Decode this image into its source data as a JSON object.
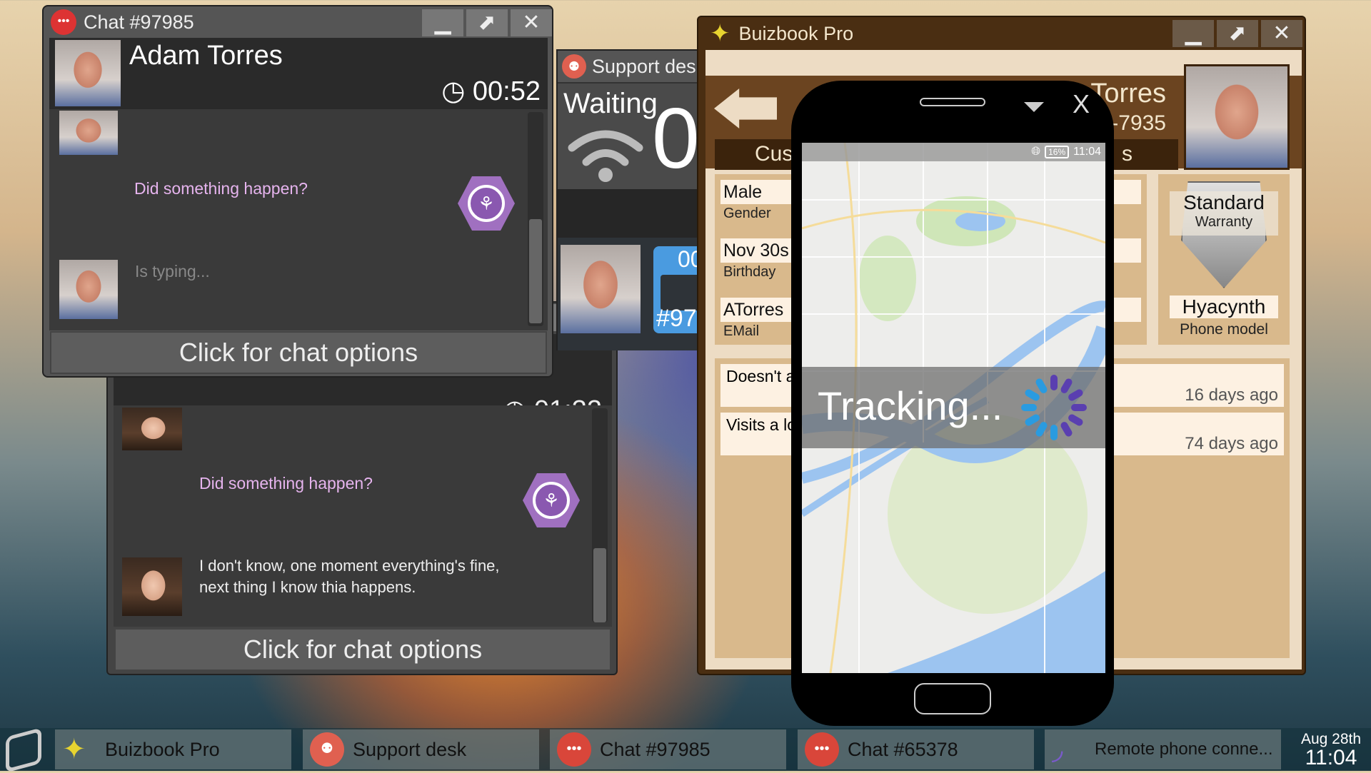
{
  "chat2": {
    "timer": "01:32",
    "messages": [
      {
        "text": "Did something happen?"
      },
      {
        "text": "I don't know, one moment everything's fine, next thing I know thia happens."
      }
    ],
    "options_label": "Click for chat options",
    "close_label": "✕"
  },
  "chat1": {
    "title": "Chat #97985",
    "name": "Adam Torres",
    "timer": "00:52",
    "messages": [
      {
        "text": "Did something happen?"
      },
      {
        "text": "Is typing..."
      }
    ],
    "options_label": "Click for chat options",
    "buttons": {
      "minimize": "▁",
      "popout": "⬈",
      "close": "✕"
    }
  },
  "support": {
    "title": "Support des",
    "waiting_label": "Waiting",
    "waiting_count": "0",
    "card_time": "00",
    "card_id": "#97"
  },
  "buizbook": {
    "title": "Buizbook Pro",
    "buttons": {
      "minimize": "▁",
      "popout": "⬈",
      "close": "✕"
    },
    "name": "Torres",
    "phone": "-7935",
    "tabs": {
      "left": "Cus",
      "right": "s"
    },
    "fields": [
      {
        "value": "Male",
        "label": "Gender"
      },
      {
        "value": "Nov 30s",
        "label": "Birthday"
      },
      {
        "value": "ATorres",
        "label": "EMail"
      }
    ],
    "warranty": {
      "line1": "Standard",
      "line2": "Warranty"
    },
    "phone_model": {
      "value": "Hyacynth",
      "label": "Phone model"
    },
    "notes": [
      {
        "text": "Doesn't a",
        "time": "16 days ago"
      },
      {
        "text": "Visits a lo",
        "time": "74 days ago"
      }
    ]
  },
  "phone": {
    "close": "X",
    "status": {
      "battery": "16%",
      "time": "11:04",
      "icon": "globe-icon"
    },
    "tracking": "Tracking..."
  },
  "taskbar": {
    "items": [
      {
        "label": "Buizbook Pro",
        "icon": "bird-icon"
      },
      {
        "label": "Support desk",
        "icon": "support-icon"
      },
      {
        "label": "Chat #97985",
        "icon": "chat-icon"
      },
      {
        "label": "Chat #65378",
        "icon": "chat-icon"
      },
      {
        "label": "Remote phone conne...",
        "icon": "signal-icon"
      }
    ],
    "date": "Aug 28th",
    "time": "11:04"
  },
  "colors": {
    "chat_purple": "#e6b4ee",
    "brown": "#6b4420",
    "accent_blue": "#4a9be0"
  }
}
